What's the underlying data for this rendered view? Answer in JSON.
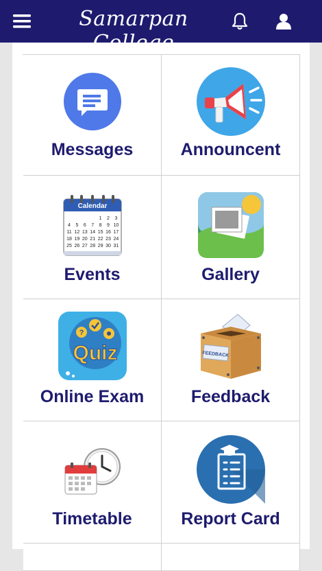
{
  "app": {
    "title": "Samarpan College"
  },
  "header": {
    "menu_icon": "hamburger-menu-icon",
    "bell_icon": "bell-icon",
    "user_icon": "user-icon"
  },
  "colors": {
    "header": "#1e1b6e",
    "label": "#1e1b6e"
  },
  "tiles": [
    {
      "label": "Messages",
      "icon": "messages-icon"
    },
    {
      "label": "Announcent",
      "icon": "megaphone-icon"
    },
    {
      "label": "Events",
      "icon": "calendar-icon"
    },
    {
      "label": "Gallery",
      "icon": "gallery-icon"
    },
    {
      "label": "Online Exam",
      "icon": "quiz-icon"
    },
    {
      "label": "Feedback",
      "icon": "feedback-box-icon"
    },
    {
      "label": "Timetable",
      "icon": "timetable-icon"
    },
    {
      "label": "Report Card",
      "icon": "report-card-icon"
    }
  ],
  "calendar": {
    "title": "Calendar",
    "days": [
      "",
      "",
      "",
      "",
      "1",
      "2",
      "3",
      "4",
      "5",
      "6",
      "7",
      "8",
      "9",
      "10",
      "11",
      "12",
      "13",
      "14",
      "15",
      "16",
      "17",
      "18",
      "19",
      "20",
      "21",
      "22",
      "23",
      "24",
      "25",
      "26",
      "27",
      "28",
      "29",
      "30",
      "31"
    ]
  },
  "quiz_word": "Quiz",
  "feedback_word": "FEEDBACK"
}
